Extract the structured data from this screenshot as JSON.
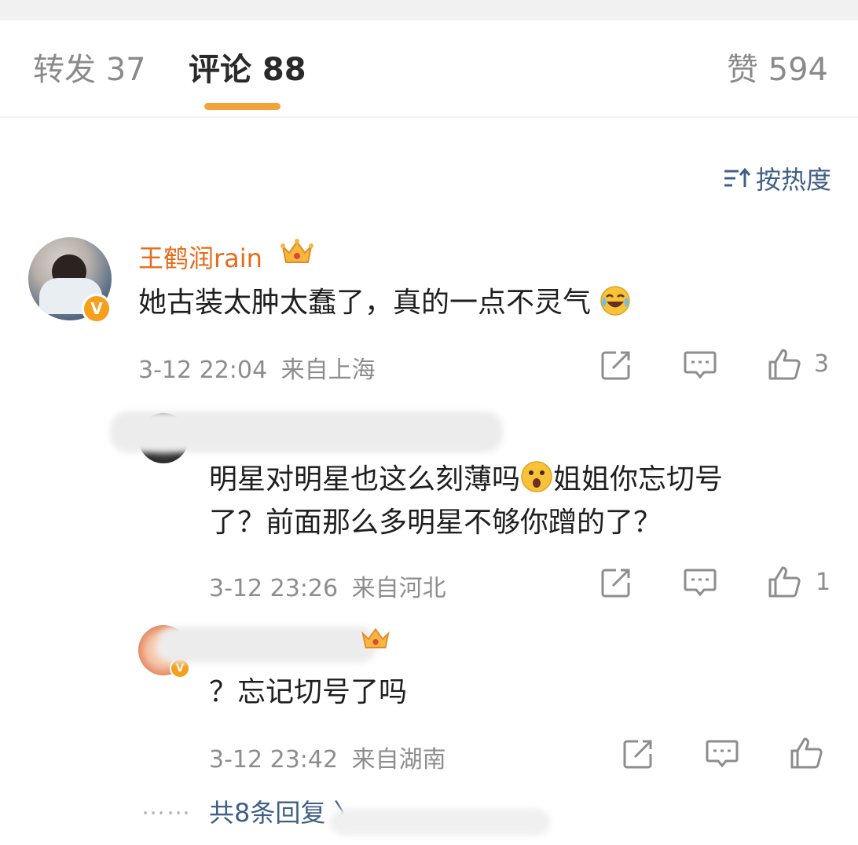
{
  "tabs": {
    "repost": "转发 37",
    "comments": "评论 88",
    "likes": "赞 594"
  },
  "sort": {
    "label": "按热度"
  },
  "comments": [
    {
      "username": "王鹤润rain",
      "text": "她古装太肿太蠢了，真的一点不灵气",
      "time": "3-12 22:04",
      "location": "来自上海",
      "likes": "3"
    },
    {
      "username": "",
      "text_line1": "明星对明星也这么刻薄吗",
      "text_line1b": "姐姐你忘切号",
      "text_line2": "了？前面那么多明星不够你蹭的了？",
      "time": "3-12 23:26",
      "location": "来自河北",
      "likes": "1"
    },
    {
      "username": "",
      "text": "？忘记切号了吗",
      "time": "3-12 23:42",
      "location": "来自湖南",
      "likes": ""
    }
  ],
  "footer": {
    "dots": "……",
    "replies": "共8条回复 〉"
  },
  "colors": {
    "accent": "#f2a23a",
    "username": "#e86b1a",
    "link": "#3f5f86",
    "meta": "#8d8d8d"
  },
  "icons": [
    "sort-icon",
    "share-icon",
    "comment-icon",
    "like-icon",
    "crown-icon",
    "verified-badge-icon",
    "laugh-cry-emoji",
    "shocked-emoji"
  ]
}
